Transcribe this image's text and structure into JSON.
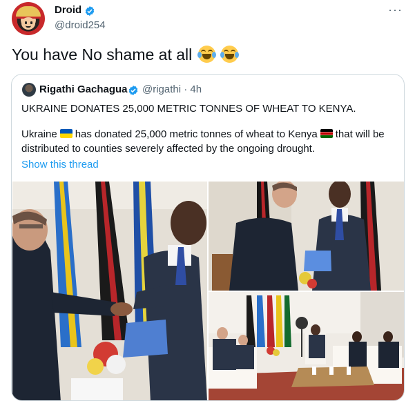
{
  "tweet": {
    "author_name": "Droid",
    "author_handle": "@droid254",
    "text": "You have No shame at all",
    "emojis": [
      "face-with-tears-of-joy-icon",
      "face-with-tears-of-joy-icon"
    ],
    "more_label": "···"
  },
  "quote": {
    "author_name": "Rigathi Gachagua",
    "author_handle": "@rigathi · 4h",
    "headline": "UKRAINE DONATES 25,000 METRIC TONNES OF WHEAT TO KENYA.",
    "body_part1": "Ukraine",
    "body_part2": "has donated 25,000 metric tonnes of wheat to Kenya",
    "body_part3": "that will be",
    "body_line2": "distributed to counties severely affected by the ongoing drought.",
    "show_thread": "Show this thread"
  },
  "colors": {
    "accent": "#1d9bf0",
    "text": "#0f1419",
    "secondary": "#536471",
    "border": "#cfd9de"
  }
}
